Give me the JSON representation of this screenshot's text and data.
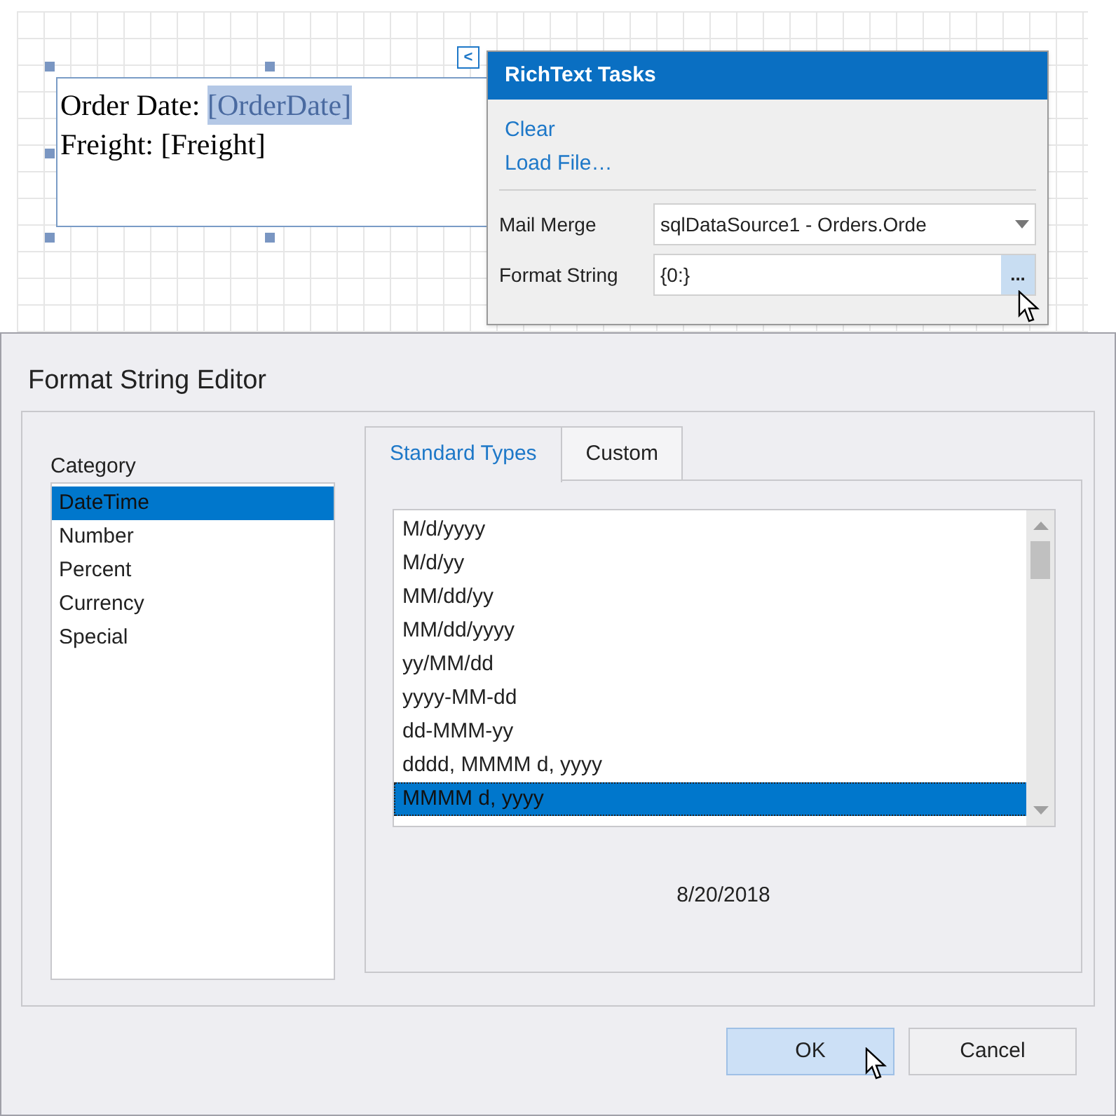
{
  "designer": {
    "field_lines": [
      {
        "label": "Order Date: ",
        "field": "[OrderDate]",
        "selected": true
      },
      {
        "label": "Freight: ",
        "field": "[Freight]",
        "selected": false
      }
    ],
    "smart_tag": "<"
  },
  "tasks_panel": {
    "title": "RichText Tasks",
    "links": [
      "Clear",
      "Load File…"
    ],
    "mail_merge": {
      "label": "Mail Merge",
      "value": "sqlDataSource1 - Orders.Orde"
    },
    "format_string": {
      "label": "Format String",
      "value": "{0:}",
      "button": "..."
    }
  },
  "dialog": {
    "title": "Format String Editor",
    "category": {
      "label": "Category",
      "items": [
        {
          "label": "DateTime",
          "selected": true
        },
        {
          "label": "Number",
          "selected": false
        },
        {
          "label": "Percent",
          "selected": false
        },
        {
          "label": "Currency",
          "selected": false
        },
        {
          "label": "Special",
          "selected": false
        }
      ]
    },
    "tabs": [
      {
        "label": "Standard Types",
        "selected": true
      },
      {
        "label": "Custom",
        "selected": false
      }
    ],
    "formats": [
      {
        "label": "M/d/yyyy",
        "selected": false
      },
      {
        "label": "M/d/yy",
        "selected": false
      },
      {
        "label": "MM/dd/yy",
        "selected": false
      },
      {
        "label": "MM/dd/yyyy",
        "selected": false
      },
      {
        "label": "yy/MM/dd",
        "selected": false
      },
      {
        "label": "yyyy-MM-dd",
        "selected": false
      },
      {
        "label": "dd-MMM-yy",
        "selected": false
      },
      {
        "label": "dddd, MMMM d, yyyy",
        "selected": false
      },
      {
        "label": "MMMM d, yyyy",
        "selected": true
      }
    ],
    "preview": "8/20/2018",
    "buttons": [
      {
        "label": "OK",
        "selected": true
      },
      {
        "label": "Cancel",
        "selected": false
      }
    ]
  }
}
